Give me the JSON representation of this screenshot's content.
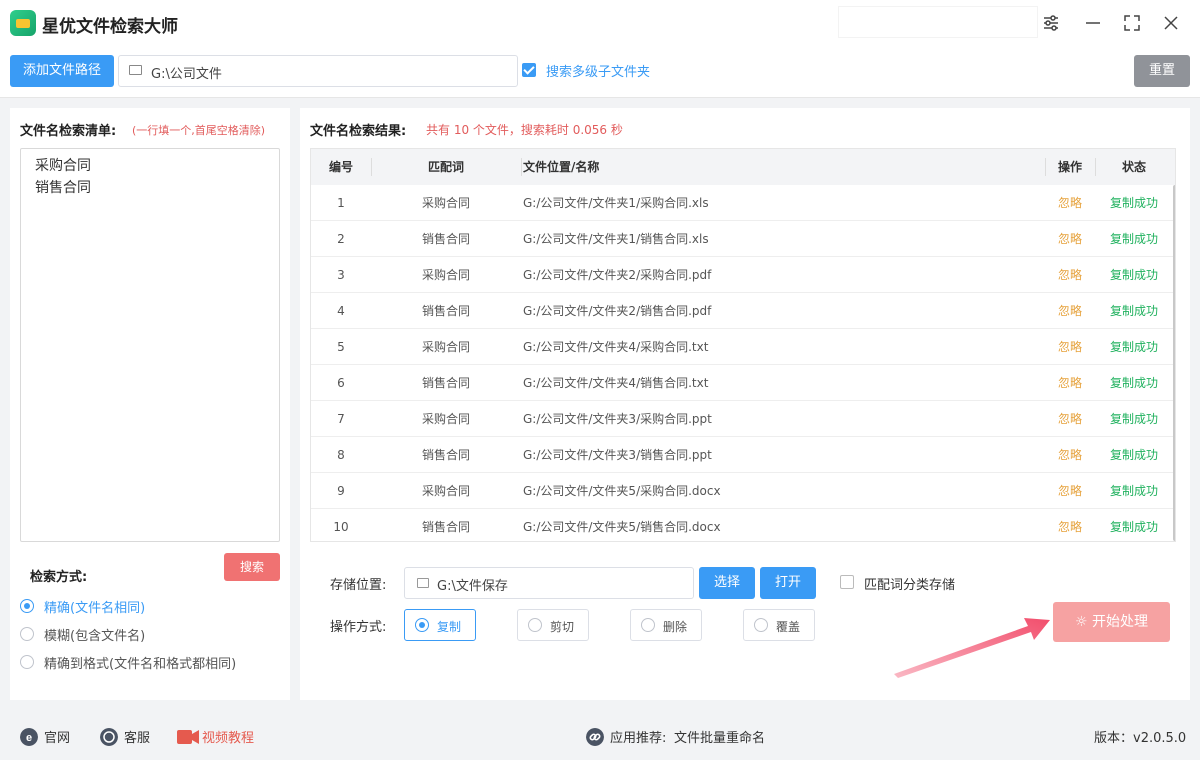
{
  "app": {
    "title": "星优文件检索大师"
  },
  "toolbar": {
    "add_path_label": "添加文件路径",
    "path_value": "G:\\公司文件",
    "search_subfolders_label": "搜索多级子文件夹",
    "search_subfolders_checked": true,
    "reset_label": "重置"
  },
  "left": {
    "list_title": "文件名检索清单:",
    "list_hint": "(一行填一个,首尾空格清除)",
    "keywords": [
      "采购合同",
      "销售合同"
    ],
    "search_label": "搜索",
    "mode_title": "检索方式:",
    "modes": [
      {
        "label": "精确(文件名相同)",
        "selected": true
      },
      {
        "label": "模糊(包含文件名)",
        "selected": false
      },
      {
        "label": "精确到格式(文件名和格式都相同)",
        "selected": false
      }
    ]
  },
  "right": {
    "result_title": "文件名检索结果:",
    "result_info": "共有 10 个文件，搜索耗时 0.056 秒",
    "columns": [
      "编号",
      "匹配词",
      "文件位置/名称",
      "操作",
      "状态"
    ],
    "rows": [
      {
        "no": "1",
        "keyword": "采购合同",
        "path": "G:/公司文件/文件夹1/采购合同.xls",
        "op": "忽略",
        "status": "复制成功"
      },
      {
        "no": "2",
        "keyword": "销售合同",
        "path": "G:/公司文件/文件夹1/销售合同.xls",
        "op": "忽略",
        "status": "复制成功"
      },
      {
        "no": "3",
        "keyword": "采购合同",
        "path": "G:/公司文件/文件夹2/采购合同.pdf",
        "op": "忽略",
        "status": "复制成功"
      },
      {
        "no": "4",
        "keyword": "销售合同",
        "path": "G:/公司文件/文件夹2/销售合同.pdf",
        "op": "忽略",
        "status": "复制成功"
      },
      {
        "no": "5",
        "keyword": "采购合同",
        "path": "G:/公司文件/文件夹4/采购合同.txt",
        "op": "忽略",
        "status": "复制成功"
      },
      {
        "no": "6",
        "keyword": "销售合同",
        "path": "G:/公司文件/文件夹4/销售合同.txt",
        "op": "忽略",
        "status": "复制成功"
      },
      {
        "no": "7",
        "keyword": "采购合同",
        "path": "G:/公司文件/文件夹3/采购合同.ppt",
        "op": "忽略",
        "status": "复制成功"
      },
      {
        "no": "8",
        "keyword": "销售合同",
        "path": "G:/公司文件/文件夹3/销售合同.ppt",
        "op": "忽略",
        "status": "复制成功"
      },
      {
        "no": "9",
        "keyword": "采购合同",
        "path": "G:/公司文件/文件夹5/采购合同.docx",
        "op": "忽略",
        "status": "复制成功"
      },
      {
        "no": "10",
        "keyword": "销售合同",
        "path": "G:/公司文件/文件夹5/销售合同.docx",
        "op": "忽略",
        "status": "复制成功"
      }
    ],
    "storage_label": "存储位置:",
    "storage_value": "G:\\文件保存",
    "choose_label": "选择",
    "open_label": "打开",
    "classify_label": "匹配词分类存储",
    "classify_checked": false,
    "op_mode_label": "操作方式:",
    "op_modes": [
      {
        "label": "复制",
        "selected": true
      },
      {
        "label": "剪切",
        "selected": false
      },
      {
        "label": "删除",
        "selected": false
      },
      {
        "label": "覆盖",
        "selected": false
      }
    ],
    "start_label": "开始处理"
  },
  "footer": {
    "website": "官网",
    "service": "客服",
    "video": "视频教程",
    "recommend_prefix": "应用推荐:",
    "recommend_app": "文件批量重命名",
    "version": "版本：v2.0.5.0"
  },
  "colors": {
    "primary": "#3a9bf5",
    "danger": "#f07272",
    "warning": "#e6a23c",
    "success": "#20b15e",
    "start_disabled": "#f6a2a2",
    "arrow": "#f24e6c"
  },
  "icons": [
    "app-logo-icon",
    "settings-sliders-icon",
    "minimize-icon",
    "maximize-icon",
    "close-icon",
    "folder-icon",
    "checkbox-icon",
    "ie-icon",
    "chat-icon",
    "video-icon",
    "link-icon",
    "spinner-icon",
    "arrow-annotation"
  ]
}
